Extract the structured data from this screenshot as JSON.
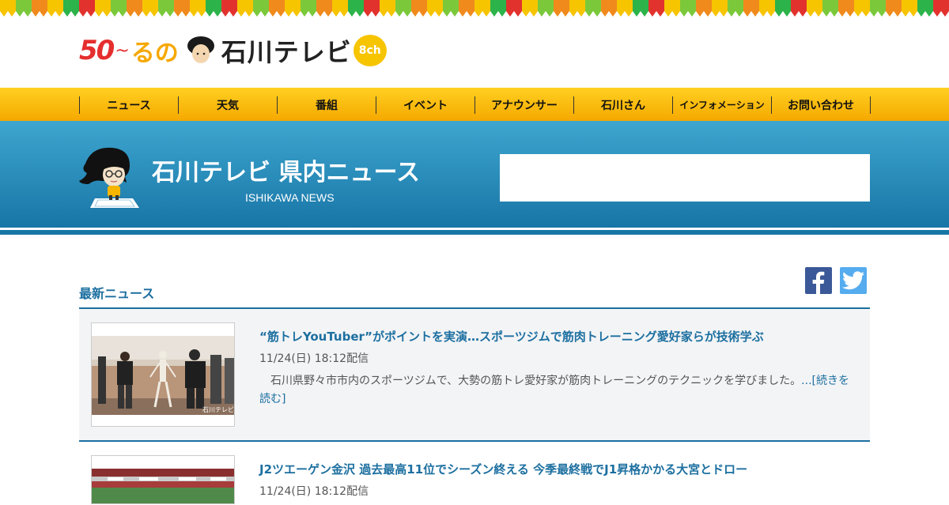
{
  "brand": {
    "anniv": "50",
    "tilde": "~",
    "runo": "るの",
    "name": "石川テレビ",
    "channel": "8ch"
  },
  "nav": {
    "items": [
      {
        "label": "ニュース"
      },
      {
        "label": "天気"
      },
      {
        "label": "番組"
      },
      {
        "label": "イベント"
      },
      {
        "label": "アナウンサー"
      },
      {
        "label": "石川さん"
      },
      {
        "label": "インフォメーション"
      },
      {
        "label": "お問い合わせ"
      }
    ]
  },
  "hero": {
    "title": "石川テレビ 県内ニュース",
    "subtitle": "ISHIKAWA NEWS"
  },
  "section": {
    "title": "最新ニュース"
  },
  "share": {
    "facebook_icon": "facebook-icon",
    "twitter_icon": "twitter-icon"
  },
  "news": [
    {
      "title": "“筋トレYouTuber”がポイントを実演…スポーツジムで筋肉トレーニング愛好家らが技術学ぶ",
      "date": "11/24(日) 18:12配信",
      "body": "石川県野々市市内のスポーツジムで、大勢の筋トレ愛好家が筋肉トレーニングのテクニックを学びました。",
      "more": "...[続きを読む]",
      "thumb_watermark": "石川テレビ"
    },
    {
      "title": "J2ツエーゲン金沢 過去最高11位でシーズン終える 今季最終戦でJ1昇格かかる大宮とドロー",
      "date": "11/24(日) 18:12配信"
    }
  ],
  "colors": {
    "accent": "#1c6fa0",
    "nav_yellow": "#f5a800",
    "hero_blue": "#1875a6"
  }
}
